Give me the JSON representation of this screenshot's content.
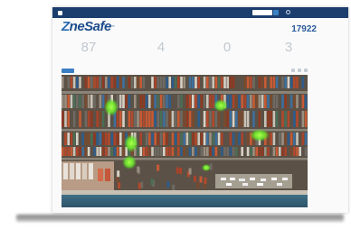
{
  "app": {
    "brand_mark_icon": "zonesafe-mark-icon"
  },
  "nav": {
    "items_count_shown": 10
  },
  "logo": {
    "text_prefix": "Z",
    "text_rest": "neSafe",
    "trademark": "™"
  },
  "header": {
    "counter": "17922"
  },
  "map": {
    "hotspot_color": "#7dff2e"
  },
  "colors": {
    "nav_bg": "#1c3e6e",
    "accent": "#3a7fc4",
    "logo": "#1e4e8c",
    "stat_value": "#c2c8d0"
  },
  "stats": [
    {
      "value": "87"
    },
    {
      "value": "4"
    },
    {
      "value": "0"
    },
    {
      "value": "3"
    }
  ]
}
